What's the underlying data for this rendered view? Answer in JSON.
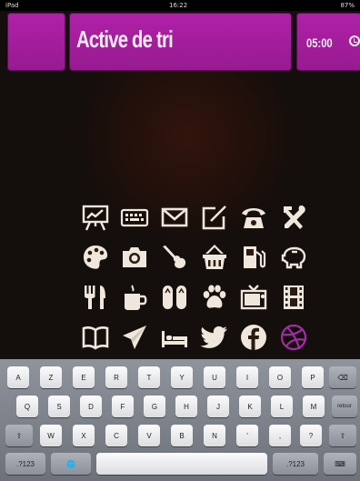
{
  "status_bar": {
    "left": "iPad",
    "center": "16:22",
    "right": "87%"
  },
  "header": {
    "title": "Active de tri",
    "time": "05:00"
  },
  "icon_grid": [
    [
      "presentation-easel-icon",
      "keyboard-icon",
      "envelope-icon",
      "edit-note-icon",
      "telephone-icon",
      "tools-hammer-wrench-icon"
    ],
    [
      "paint-palette-icon",
      "camera-icon",
      "guitar-icon",
      "shopping-basket-icon",
      "fuel-pump-icon",
      "piggy-bank-icon"
    ],
    [
      "fork-knife-icon",
      "coffee-mug-icon",
      "flip-flops-icon",
      "paw-print-icon",
      "television-icon",
      "film-strip-icon"
    ],
    [
      "open-book-icon",
      "paper-plane-icon",
      "bed-icon",
      "twitter-bird-icon",
      "facebook-icon",
      "dribbble-icon"
    ]
  ],
  "colors": {
    "header_magenta": "#a81ea0",
    "icon_cream": "#efe7dc",
    "dribbble_purple": "#a52aa8",
    "background": "#140e0c"
  },
  "keyboard": {
    "row1": [
      "A",
      "Z",
      "E",
      "R",
      "T",
      "Y",
      "U",
      "I",
      "O",
      "P",
      "⌫"
    ],
    "row2": [
      "Q",
      "S",
      "D",
      "F",
      "G",
      "H",
      "J",
      "K",
      "L",
      "M",
      "retour"
    ],
    "row3": [
      "⇧",
      "W",
      "X",
      "C",
      "V",
      "B",
      "N",
      "'",
      ",",
      "?",
      "⇧"
    ],
    "row4": {
      "numbers": ".?123",
      "globe": "🌐",
      "space": "",
      "numbers_right": ".?123",
      "dismiss": "⌨"
    }
  }
}
